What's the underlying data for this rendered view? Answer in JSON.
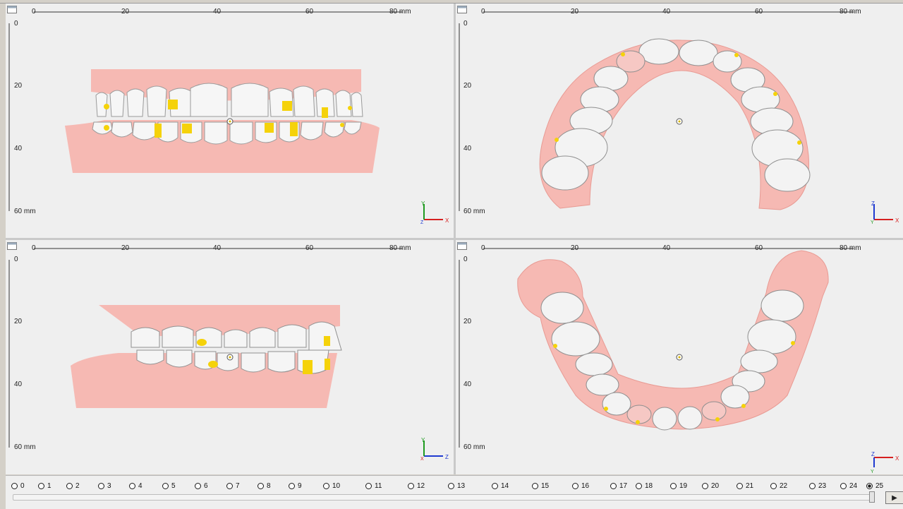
{
  "viewports": [
    {
      "id": "front",
      "xticks": [
        "0",
        "20",
        "40",
        "60",
        "80 mm"
      ],
      "yticks": [
        "0",
        "20",
        "40",
        "60 mm"
      ],
      "axis_labels": {
        "up": "Y",
        "right": "X",
        "corner": "Z"
      }
    },
    {
      "id": "upper-occlusal",
      "xticks": [
        "0",
        "20",
        "40",
        "60",
        "80 mm"
      ],
      "yticks": [
        "0",
        "20",
        "40",
        "60 mm"
      ],
      "axis_labels": {
        "up": "Z",
        "right": "X",
        "corner": "Y"
      }
    },
    {
      "id": "lateral",
      "xticks": [
        "0",
        "20",
        "40",
        "60",
        "80 mm"
      ],
      "yticks": [
        "0",
        "20",
        "40",
        "60 mm"
      ],
      "axis_labels": {
        "up": "Y",
        "right": "Z",
        "corner": "X"
      }
    },
    {
      "id": "lower-occlusal",
      "xticks": [
        "0",
        "20",
        "40",
        "60",
        "80 mm"
      ],
      "yticks": [
        "0",
        "20",
        "40",
        "60 mm"
      ],
      "axis_labels": {
        "up": "Z",
        "right": "X",
        "corner": "Y"
      }
    }
  ],
  "timeline": {
    "stages": [
      "0",
      "1",
      "2",
      "3",
      "4",
      "5",
      "6",
      "7",
      "8",
      "9",
      "10",
      "11",
      "12",
      "13",
      "14",
      "15",
      "16",
      "17",
      "18",
      "19",
      "20",
      "21",
      "22",
      "23",
      "24",
      "25"
    ],
    "selected_stage": "25",
    "play_icon": "play-icon"
  },
  "colors": {
    "gum": "#f6b9b3",
    "tooth": "#f4f4f4",
    "attachment": "#f5d20a",
    "axis_x": "#d62020",
    "axis_y": "#1f9a20",
    "axis_z": "#1f3ad0"
  }
}
